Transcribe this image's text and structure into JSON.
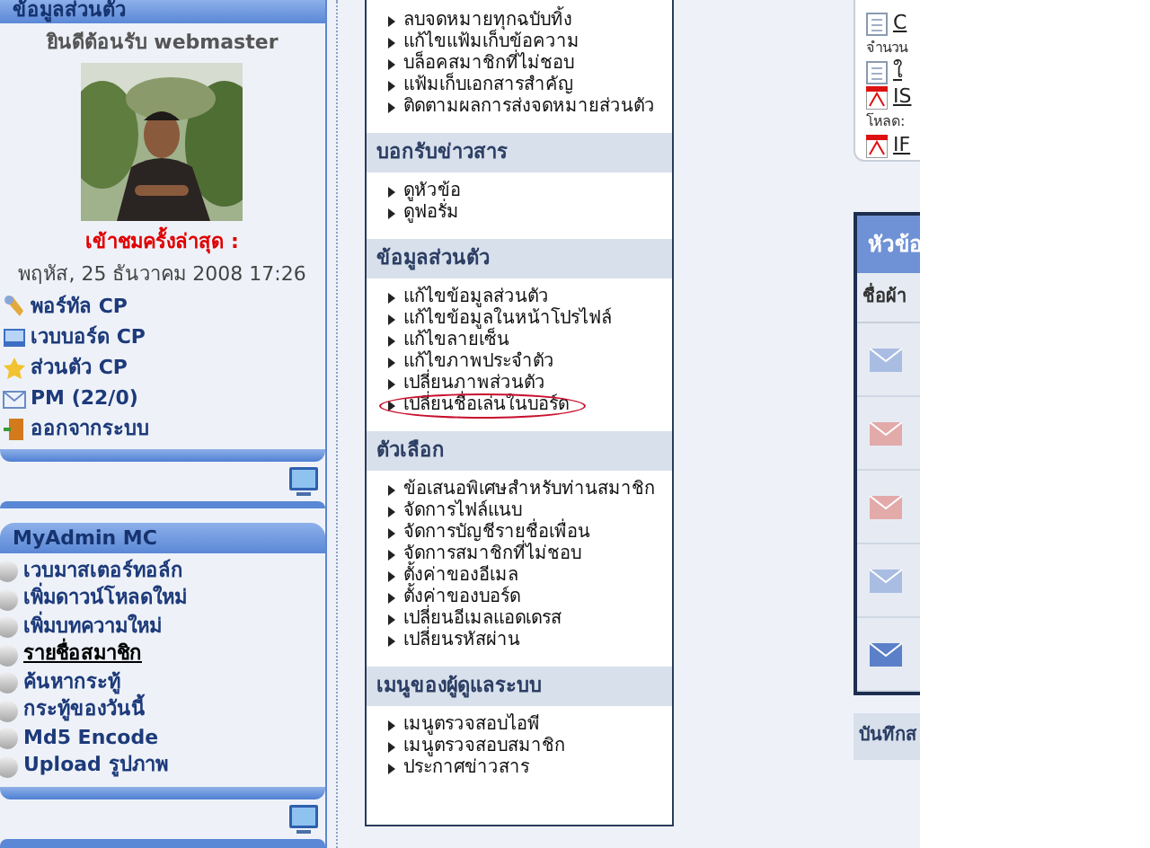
{
  "profile_panel": {
    "title": "ข้อมูลส่วนตัว",
    "welcome": "ยินดีต้อนรับ webmaster",
    "last_visit_label": "เข้าชมครั้งล่าสุด :",
    "last_visit_date": "พฤหัส, 25 ธันวาคม 2008 17:26",
    "links": [
      {
        "kind": "wrench",
        "label": "พอร์ทัล CP"
      },
      {
        "kind": "board",
        "label": "เวบบอร์ด CP"
      },
      {
        "kind": "star",
        "label": "ส่วนตัว CP"
      },
      {
        "kind": "mail",
        "label": "PM (22/0)"
      },
      {
        "kind": "exit",
        "label": "ออกจากระบบ"
      }
    ]
  },
  "admin_panel": {
    "title": "MyAdmin MC",
    "links": [
      {
        "label": "เวบมาสเตอร์ทอล์ก",
        "selected": false
      },
      {
        "label": "เพิ่มดาวน์โหลดใหม่",
        "selected": false
      },
      {
        "label": "เพิ่มบทความใหม่",
        "selected": false
      },
      {
        "label": "รายชื่อสมาชิก",
        "selected": true
      },
      {
        "label": "ค้นหากระทู้",
        "selected": false
      },
      {
        "label": "กระทู้ของวันนี้",
        "selected": false
      },
      {
        "label": "Md5 Encode",
        "selected": false
      },
      {
        "label": "Upload รูปภาพ",
        "selected": false
      }
    ]
  },
  "menu_panel": {
    "top_items": [
      "ลบจดหมายทุกฉบับทิ้ง",
      "แก้ไขแฟ้มเก็บข้อความ",
      "บล็อคสมาชิกที่ไม่ชอบ",
      "แฟ้มเก็บเอกสารสำคัญ",
      "ติดตามผลการส่งจดหมายส่วนตัว"
    ],
    "sections": [
      {
        "title": "บอกรับข่าวสาร",
        "items": [
          {
            "label": "ดูหัวข้อ",
            "circled": false
          },
          {
            "label": "ดูฟอรั่ม",
            "circled": false
          }
        ]
      },
      {
        "title": "ข้อมูลส่วนตัว",
        "items": [
          {
            "label": "แก้ไขข้อมูลส่วนตัว",
            "circled": false
          },
          {
            "label": "แก้ไขข้อมูลในหน้าโปรไฟล์",
            "circled": false
          },
          {
            "label": "แก้ไขลายเซ็น",
            "circled": false
          },
          {
            "label": "แก้ไขภาพประจำตัว",
            "circled": false
          },
          {
            "label": "เปลี่ยนภาพส่วนตัว",
            "circled": false
          },
          {
            "label": "เปลี่ยนชื่อเล่นในบอร์ด",
            "circled": true
          }
        ]
      },
      {
        "title": "ตัวเลือก",
        "items": [
          {
            "label": "ข้อเสนอพิเศษสำหรับท่านสมาชิก",
            "circled": false
          },
          {
            "label": "จัดการไฟล์แนบ",
            "circled": false
          },
          {
            "label": "จัดการบัญชีรายชื่อเพื่อน",
            "circled": false
          },
          {
            "label": "จัดการสมาชิกที่ไม่ชอบ",
            "circled": false
          },
          {
            "label": "ตั้งค่าของอีเมล",
            "circled": false
          },
          {
            "label": "ตั้งค่าของบอร์ด",
            "circled": false
          },
          {
            "label": "เปลี่ยนอีเมลแอดเดรส",
            "circled": false
          },
          {
            "label": "เปลี่ยนรหัสผ่าน",
            "circled": false
          }
        ]
      },
      {
        "title": "เมนูของผู้ดูแลระบบ",
        "items": [
          {
            "label": "เมนูตรวจสอบไอพี",
            "circled": false
          },
          {
            "label": "เมนูตรวจสอบสมาชิก",
            "circled": false
          },
          {
            "label": "ประกาศข่าวสาร",
            "circled": false
          }
        ]
      }
    ]
  },
  "right_column": {
    "files": [
      {
        "kind": "doc",
        "label": "C"
      },
      {
        "kind": "text",
        "label": "จำนวน"
      },
      {
        "kind": "doc",
        "label": "ใ"
      },
      {
        "kind": "pdf",
        "label": "IS"
      },
      {
        "kind": "text",
        "label": "โหลด:"
      },
      {
        "kind": "pdf",
        "label": "IF"
      }
    ],
    "table": {
      "title": "หัวข้อ",
      "column_1": "ชื่อผ้า",
      "rows": [
        {
          "color": "#a9bde3"
        },
        {
          "color": "#e3aaaa"
        },
        {
          "color": "#e3aaaa"
        },
        {
          "color": "#a9bde3"
        },
        {
          "color": "#5b80c9"
        }
      ]
    },
    "footer": "บันทึกส"
  }
}
